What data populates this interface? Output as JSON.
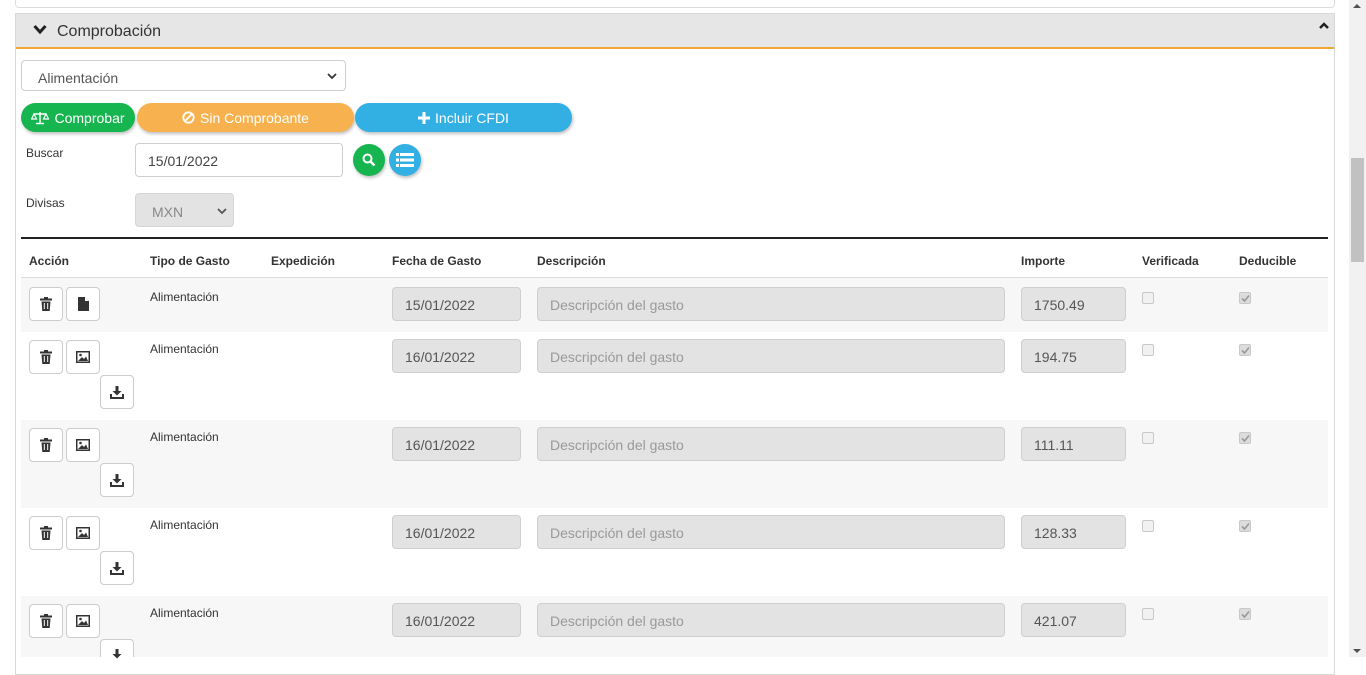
{
  "panel": {
    "title": "Comprobación"
  },
  "category_select": {
    "value": "Alimentación"
  },
  "buttons": {
    "comprobar": "Comprobar",
    "sin_comprobante": "Sin Comprobante",
    "incluir_cfdi": "Incluir CFDI"
  },
  "search": {
    "label": "Buscar",
    "value": "15/01/2022"
  },
  "divisas": {
    "label": "Divisas",
    "value": "MXN"
  },
  "table": {
    "headers": {
      "accion": "Acción",
      "tipo": "Tipo de Gasto",
      "expedicion": "Expedición",
      "fecha": "Fecha de Gasto",
      "descripcion": "Descripción",
      "importe": "Importe",
      "verificada": "Verificada",
      "deducible": "Deducible"
    },
    "rows": [
      {
        "tipo": "Alimentación",
        "fecha": "15/01/2022",
        "descripcion": "Descripción del gasto",
        "importe": "1750.49",
        "verificada": false,
        "deducible": true,
        "attachment": "file-icon"
      },
      {
        "tipo": "Alimentación",
        "fecha": "16/01/2022",
        "descripcion": "Descripción del gasto",
        "importe": "194.75",
        "verificada": false,
        "deducible": true,
        "attachment": "image-icon"
      },
      {
        "tipo": "Alimentación",
        "fecha": "16/01/2022",
        "descripcion": "Descripción del gasto",
        "importe": "111.11",
        "verificada": false,
        "deducible": true,
        "attachment": "image-icon"
      },
      {
        "tipo": "Alimentación",
        "fecha": "16/01/2022",
        "descripcion": "Descripción del gasto",
        "importe": "128.33",
        "verificada": false,
        "deducible": true,
        "attachment": "image-icon"
      },
      {
        "tipo": "Alimentación",
        "fecha": "16/01/2022",
        "descripcion": "Descripción del gasto",
        "importe": "421.07",
        "verificada": false,
        "deducible": true,
        "attachment": "image-icon"
      }
    ]
  },
  "colors": {
    "green": "#17b54f",
    "orange": "#f7b24f",
    "blue": "#33b0e3",
    "header_accent": "#f0a830"
  }
}
